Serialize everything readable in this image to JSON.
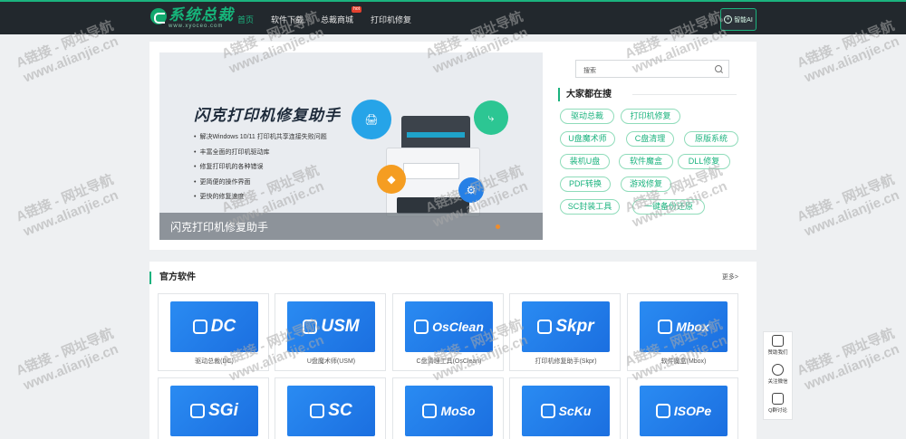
{
  "header": {
    "logo_text": "系统总裁",
    "logo_url": "www.xyoceo.com",
    "nav": [
      {
        "label": "首页",
        "active": true
      },
      {
        "label": "软件下载",
        "active": false
      },
      {
        "label": "总裁商城",
        "active": false,
        "badge": "hot"
      },
      {
        "label": "打印机修复",
        "active": false
      }
    ],
    "ai_button": "智能AI"
  },
  "banner": {
    "title": "闪克打印机修复助手",
    "bullets": [
      "解决Windows 10/11 打印机共享连接失败问题",
      "丰富全面的打印机驱动库",
      "修复打印机的各种错误",
      "更简便的操作界面",
      "更快的修复速度"
    ],
    "caption": "闪克打印机修复助手"
  },
  "search": {
    "placeholder": "搜索"
  },
  "hot": {
    "title": "大家都在搜",
    "tags": [
      "驱动总裁",
      "打印机修复",
      "U盘魔术师",
      "C盘清理",
      "原版系统",
      "装机U盘",
      "软件魔盒",
      "DLL修复",
      "PDF转换",
      "游戏修复",
      "SC封装工具",
      "一键备份还原"
    ]
  },
  "software": {
    "title": "官方软件",
    "more": "更多>",
    "items": [
      {
        "logo": "DC",
        "label": "驱动总裁(DC)"
      },
      {
        "logo": "USM",
        "label": "U盘魔术师(USM)"
      },
      {
        "logo": "OsClean",
        "label": "C盘清理工具(OsClean)"
      },
      {
        "logo": "Skpr",
        "label": "打印机修复助手(Skpr)"
      },
      {
        "logo": "Mbox",
        "label": "软件魔盒(Mbox)"
      },
      {
        "logo": "SGi",
        "label": ""
      },
      {
        "logo": "SC",
        "label": ""
      },
      {
        "logo": "MoSo",
        "label": ""
      },
      {
        "logo": "ScKu",
        "label": ""
      },
      {
        "logo": "ISOPe",
        "label": ""
      }
    ]
  },
  "float_panel": {
    "items": [
      {
        "label": "赞助我们",
        "icon": "gift-icon"
      },
      {
        "label": "关注微信",
        "icon": "wechat-icon"
      },
      {
        "label": "Q群讨论",
        "icon": "chat-icon"
      }
    ]
  },
  "watermark": {
    "line1": "A链接 - 网址导航",
    "line2": "www.alianjie.cn"
  }
}
